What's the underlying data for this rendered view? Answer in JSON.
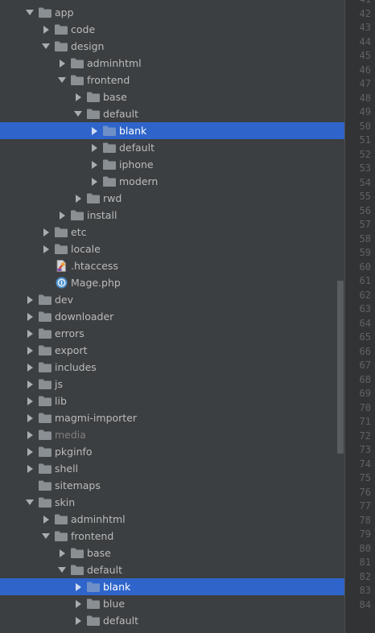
{
  "colors": {
    "panel_bg": "#3c3f41",
    "selection": "#2f65ca",
    "folder": "#8a8f93",
    "text": "#bbbbbb",
    "dim_text": "#7f7f7f",
    "gutter_bg": "#313335",
    "line_number": "#606366"
  },
  "tree": [
    {
      "label": "app",
      "depth": 0,
      "state": "expanded",
      "icon": "folder-icon"
    },
    {
      "label": "code",
      "depth": 1,
      "state": "collapsed",
      "icon": "folder-icon"
    },
    {
      "label": "design",
      "depth": 1,
      "state": "expanded",
      "icon": "folder-icon"
    },
    {
      "label": "adminhtml",
      "depth": 2,
      "state": "collapsed",
      "icon": "folder-icon"
    },
    {
      "label": "frontend",
      "depth": 2,
      "state": "expanded",
      "icon": "folder-icon"
    },
    {
      "label": "base",
      "depth": 3,
      "state": "collapsed",
      "icon": "folder-icon"
    },
    {
      "label": "default",
      "depth": 3,
      "state": "expanded",
      "icon": "folder-icon"
    },
    {
      "label": "blank",
      "depth": 4,
      "state": "collapsed",
      "icon": "folder-icon",
      "selected": true
    },
    {
      "label": "default",
      "depth": 4,
      "state": "collapsed",
      "icon": "folder-icon"
    },
    {
      "label": "iphone",
      "depth": 4,
      "state": "collapsed",
      "icon": "folder-icon"
    },
    {
      "label": "modern",
      "depth": 4,
      "state": "collapsed",
      "icon": "folder-icon"
    },
    {
      "label": "rwd",
      "depth": 3,
      "state": "collapsed",
      "icon": "folder-icon"
    },
    {
      "label": "install",
      "depth": 2,
      "state": "collapsed",
      "icon": "folder-icon"
    },
    {
      "label": "etc",
      "depth": 1,
      "state": "collapsed",
      "icon": "folder-icon"
    },
    {
      "label": "locale",
      "depth": 1,
      "state": "collapsed",
      "icon": "folder-icon"
    },
    {
      "label": ".htaccess",
      "depth": 1,
      "state": "leaf",
      "icon": "htaccess-file-icon"
    },
    {
      "label": "Mage.php",
      "depth": 1,
      "state": "leaf",
      "icon": "php-file-icon"
    },
    {
      "label": "dev",
      "depth": 0,
      "state": "collapsed",
      "icon": "folder-icon"
    },
    {
      "label": "downloader",
      "depth": 0,
      "state": "collapsed",
      "icon": "folder-icon"
    },
    {
      "label": "errors",
      "depth": 0,
      "state": "collapsed",
      "icon": "folder-icon"
    },
    {
      "label": "export",
      "depth": 0,
      "state": "collapsed",
      "icon": "folder-icon"
    },
    {
      "label": "includes",
      "depth": 0,
      "state": "collapsed",
      "icon": "folder-icon"
    },
    {
      "label": "js",
      "depth": 0,
      "state": "collapsed",
      "icon": "folder-icon"
    },
    {
      "label": "lib",
      "depth": 0,
      "state": "collapsed",
      "icon": "folder-icon"
    },
    {
      "label": "magmi-importer",
      "depth": 0,
      "state": "collapsed",
      "icon": "folder-icon"
    },
    {
      "label": "media",
      "depth": 0,
      "state": "collapsed",
      "icon": "folder-icon",
      "dim": true
    },
    {
      "label": "pkginfo",
      "depth": 0,
      "state": "collapsed",
      "icon": "folder-icon"
    },
    {
      "label": "shell",
      "depth": 0,
      "state": "collapsed",
      "icon": "folder-icon"
    },
    {
      "label": "sitemaps",
      "depth": 0,
      "state": "leaf",
      "icon": "folder-icon"
    },
    {
      "label": "skin",
      "depth": 0,
      "state": "expanded",
      "icon": "folder-icon"
    },
    {
      "label": "adminhtml",
      "depth": 1,
      "state": "collapsed",
      "icon": "folder-icon"
    },
    {
      "label": "frontend",
      "depth": 1,
      "state": "expanded",
      "icon": "folder-icon"
    },
    {
      "label": "base",
      "depth": 2,
      "state": "collapsed",
      "icon": "folder-icon"
    },
    {
      "label": "default",
      "depth": 2,
      "state": "expanded",
      "icon": "folder-icon"
    },
    {
      "label": "blank",
      "depth": 3,
      "state": "collapsed",
      "icon": "folder-icon",
      "selected": true
    },
    {
      "label": "blue",
      "depth": 3,
      "state": "collapsed",
      "icon": "folder-icon"
    },
    {
      "label": "default",
      "depth": 3,
      "state": "collapsed",
      "icon": "folder-icon"
    }
  ],
  "gutter": {
    "line_numbers": [
      "41",
      "42",
      "43",
      "44",
      "45",
      "46",
      "47",
      "48",
      "49",
      "50",
      "51",
      "52",
      "53",
      "54",
      "55",
      "56",
      "57",
      "58",
      "59",
      "60",
      "61",
      "62",
      "63",
      "64",
      "65",
      "66",
      "67",
      "68",
      "69",
      "70",
      "71",
      "72",
      "73",
      "74",
      "75",
      "76",
      "77",
      "78",
      "79",
      "80",
      "81",
      "82",
      "83",
      "84"
    ]
  }
}
